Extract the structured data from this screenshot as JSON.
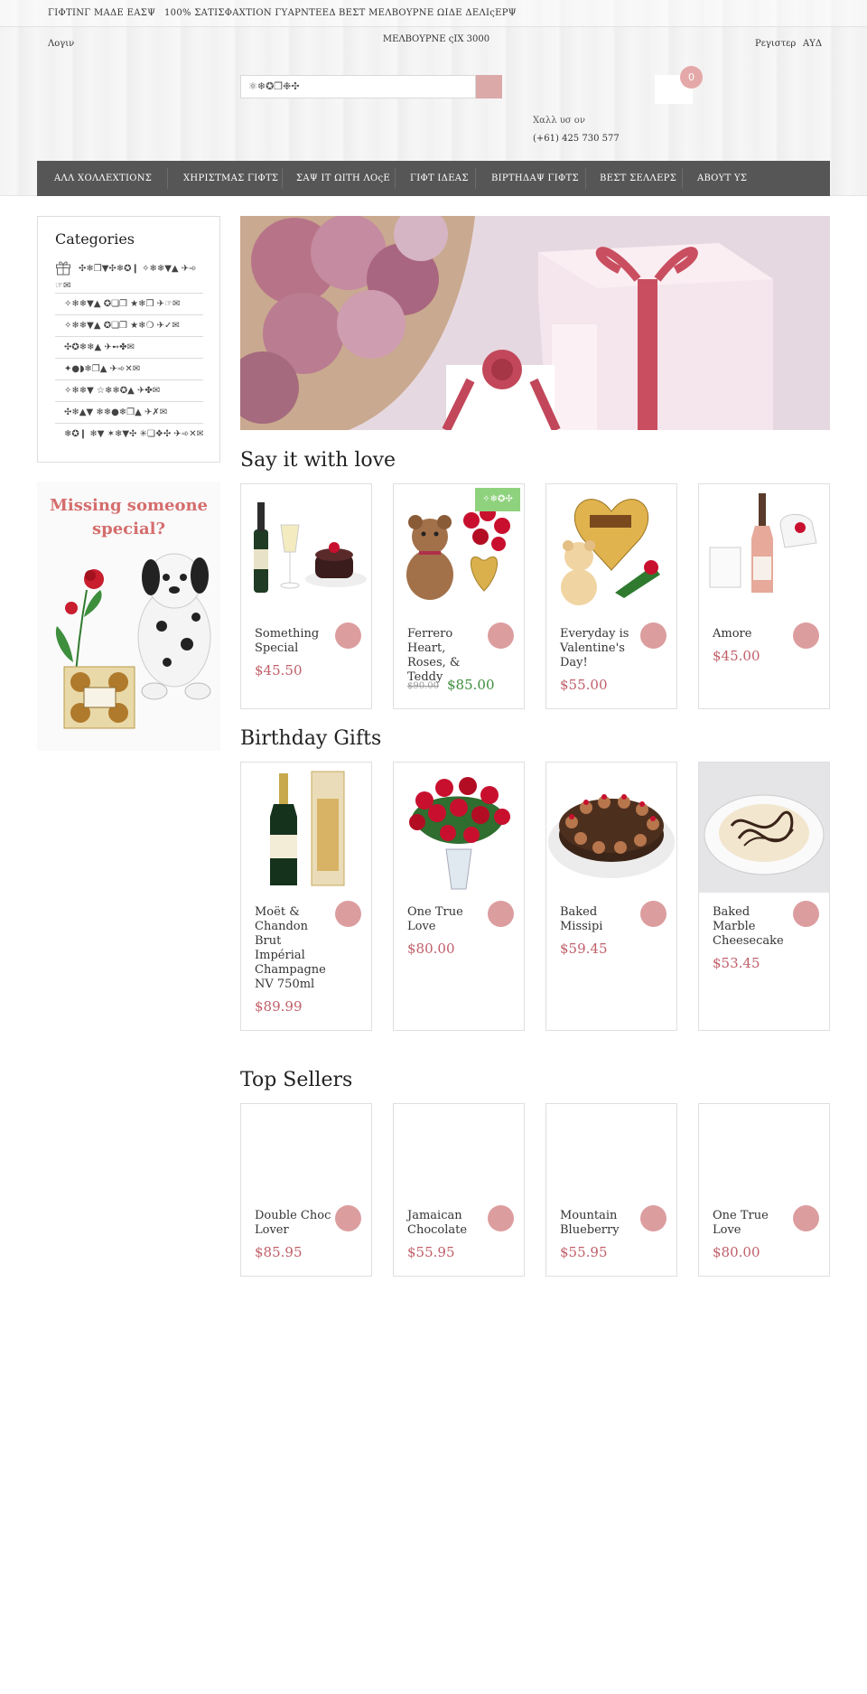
{
  "topbar": {
    "item1": "ΓΙΦΤΙΝΓ ΜΑΔΕ ΕΑΣΨ",
    "item2": "100% ΣΑΤΙΣΦΑΧΤΙΟΝ ΓΥΑΡΝΤΕΕΔ",
    "item3": "ΒΕΣΤ ΜΕΛΒΟΥΡΝΕ ΩΙΔΕ ΔΕΛΙςΕΡΨ"
  },
  "header": {
    "login": "Λογιν",
    "location": "ΜΕΛΒΟΥΡΝΕ ςΙΧ 3000",
    "register": "Ρεγιστερ",
    "currency": "ΑΥΔ",
    "search_value": "⚛❄✪❒❉✣",
    "cart_count": "0",
    "call_us": "Χαλλ υσ ον",
    "phone": "(+61) 425 730 577"
  },
  "nav": {
    "items": [
      "ΑΛΛ ΧΟΛΛΕΧΤΙΟΝΣ",
      "ΧΗΡΙΣΤΜΑΣ ΓΙΦΤΣ",
      "ΣΑΨ ΙΤ ΩΙΤΗ ΛΟςΕ",
      "ΓΙΦΤ ΙΔΕΑΣ",
      "ΒΙΡΤΗΔΑΨ ΓΙΦΤΣ",
      "ΒΕΣΤ ΣΕΛΛΕΡΣ",
      "ΑΒΟΥΤ ΥΣ"
    ]
  },
  "sidebar": {
    "title": "Categories",
    "main_category": "✣❄❒▼✣❄✪❙ ✧❄❄▼▲ ✈➾☞✉",
    "items": [
      "✧❄❄▼▲ ✪❏❒ ★❄❒ ✈☞✉",
      "✧❄❄▼▲ ✪❏❒ ★❄❍ ✈✓✉",
      "✣✪❄❄▲ ✈➻✤✉",
      "✦●◗❄❒▲ ✈➾✕✉",
      "✧❄❄▼ ☆❄❄✪▲ ✈✤✉",
      "✣❄▲▼ ❄❄●❄❒▲ ✈✗✉",
      "❄✪❙ ❄▼ ✶❄▼✣ ✳❏❖✣ ✈➾✕✉"
    ]
  },
  "promo": {
    "text": "Missing someone special?"
  },
  "sections": [
    {
      "title": "Say it with love",
      "products": [
        {
          "name": "Something Special",
          "price": "$45.50"
        },
        {
          "name": "Ferrero Heart, Roses, & Teddy",
          "old_price": "$90.00",
          "price": "$85.00",
          "tag": "✧❄✪✣"
        },
        {
          "name": "Everyday is Valentine's Day!",
          "price": "$55.00"
        },
        {
          "name": "Amore",
          "price": "$45.00"
        }
      ]
    },
    {
      "title": "Birthday Gifts",
      "products": [
        {
          "name": "Moët & Chandon Brut Impérial Champagne NV 750ml",
          "price": "$89.99"
        },
        {
          "name": "One True Love",
          "price": "$80.00"
        },
        {
          "name": "Baked Missipi",
          "price": "$59.45"
        },
        {
          "name": "Baked Marble Cheesecake",
          "price": "$53.45"
        }
      ]
    },
    {
      "title": "Top Sellers",
      "products": [
        {
          "name": "Double Choc Lover",
          "price": "$85.95"
        },
        {
          "name": "Jamaican Chocolate",
          "price": "$55.95"
        },
        {
          "name": "Mountain Blueberry",
          "price": "$55.95"
        },
        {
          "name": "One True Love",
          "price": "$80.00"
        }
      ]
    }
  ],
  "colors": {
    "accent": "#dc9d9f",
    "price": "#c05f69",
    "sale": "#3c8e3c",
    "nav": "#565656"
  }
}
